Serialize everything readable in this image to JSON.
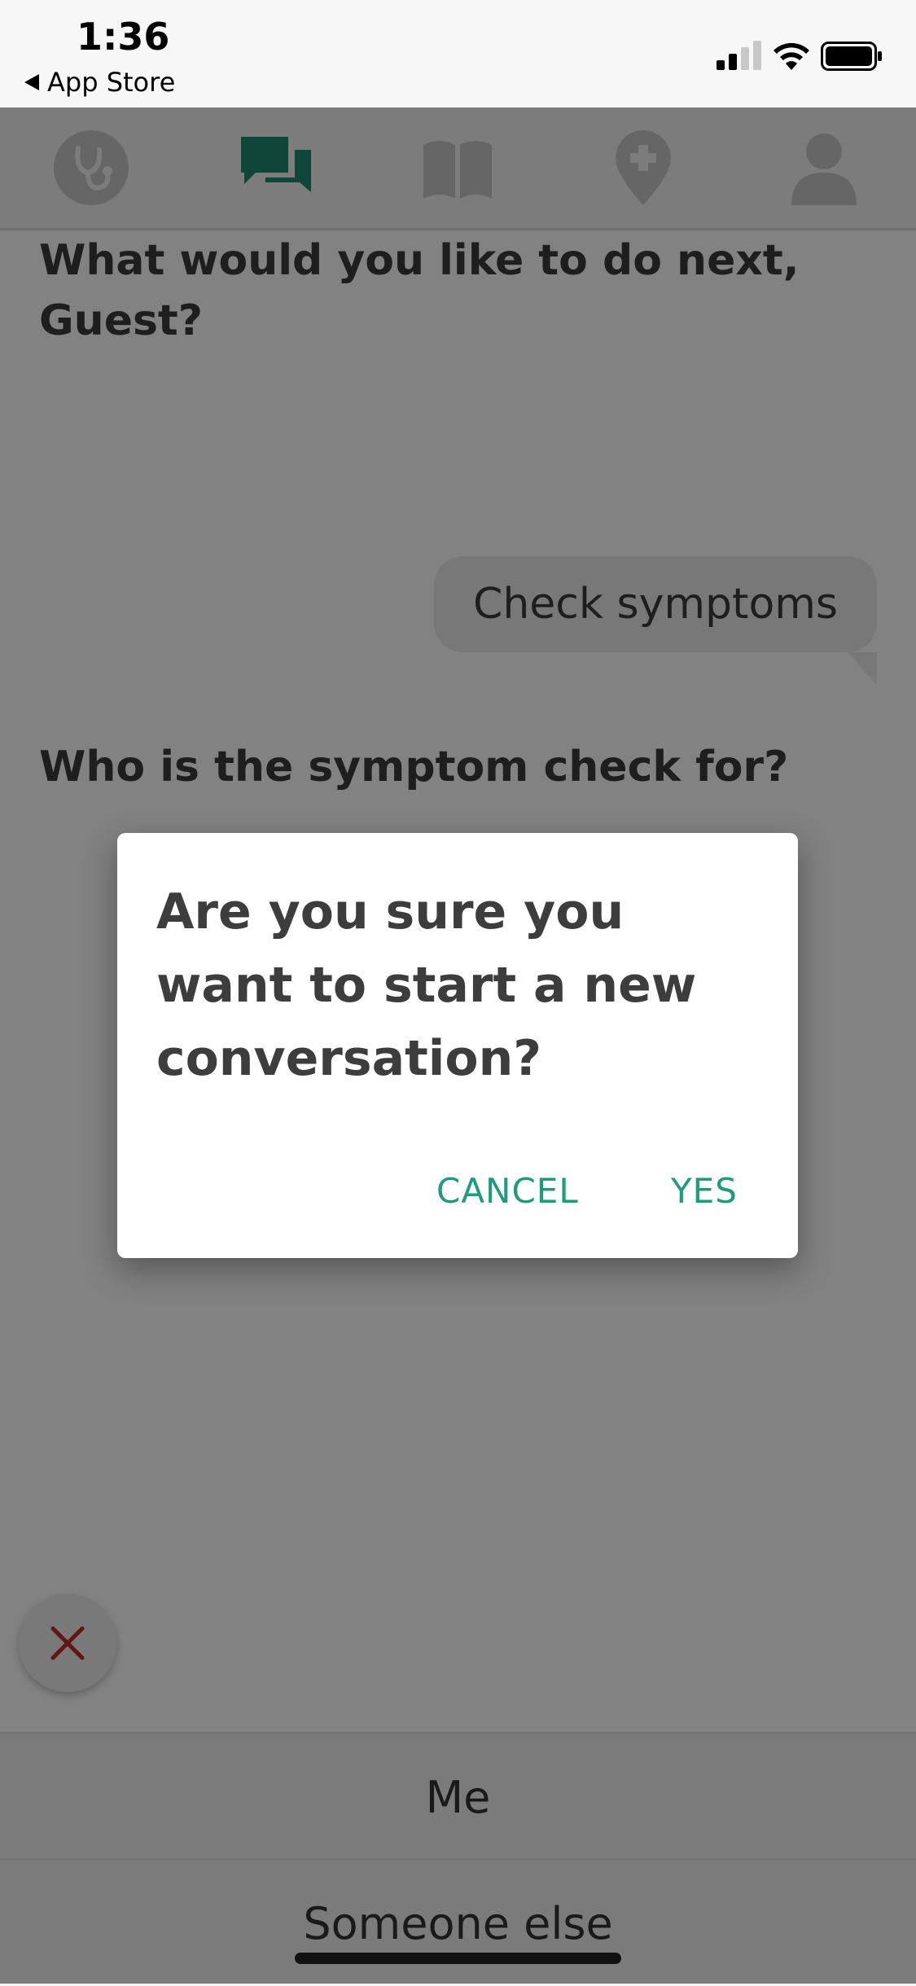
{
  "status_bar": {
    "time": "1:36",
    "back_label": "App Store"
  },
  "tabs": [
    {
      "name": "symptom-checker",
      "icon": "stethoscope-icon",
      "active": false
    },
    {
      "name": "chat",
      "icon": "chat-bubbles-icon",
      "active": true
    },
    {
      "name": "library",
      "icon": "open-book-icon",
      "active": false
    },
    {
      "name": "find-care",
      "icon": "medical-pin-icon",
      "active": false
    },
    {
      "name": "profile",
      "icon": "person-icon",
      "active": false
    }
  ],
  "chat": {
    "prompt_1": "What would you like to do next, Guest?",
    "user_reply": "Check symptoms",
    "prompt_2": "Who is the symptom check for?"
  },
  "quick_replies": {
    "option_1": "Me",
    "option_2": "Someone else"
  },
  "dialog": {
    "title": "Are you sure you want to start a new conversation?",
    "cancel_label": "CANCEL",
    "confirm_label": "YES"
  },
  "colors": {
    "accent": "#1e9a7c",
    "close_icon": "#c62828",
    "overlay": "rgba(0,0,0,0.49)"
  }
}
